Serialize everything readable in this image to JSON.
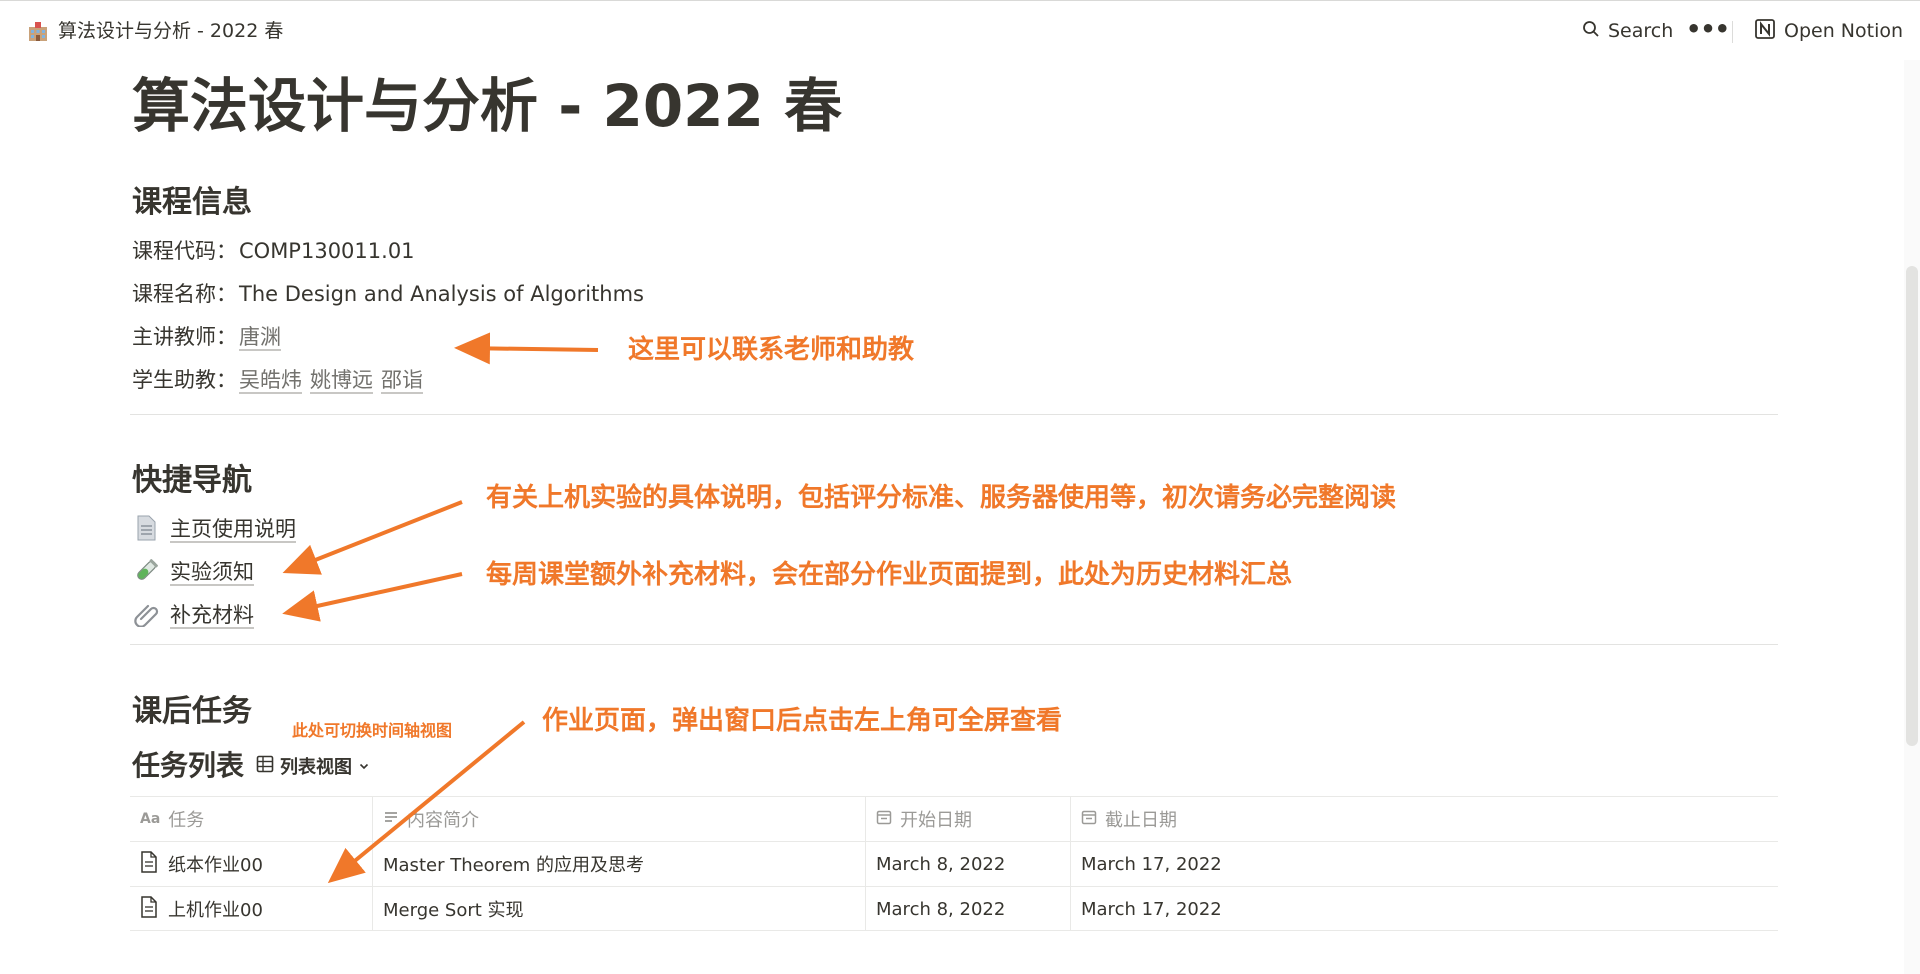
{
  "topbar": {
    "breadcrumb": "算法设计与分析 - 2022 春",
    "search_label": "Search",
    "more_label": "•••",
    "open_notion_label": "Open Notion"
  },
  "page": {
    "title": "算法设计与分析 - 2022 春"
  },
  "course_info": {
    "heading": "课程信息",
    "code_label": "课程代码：",
    "code_value": "COMP130011.01",
    "name_label": "课程名称：",
    "name_value": "The Design and Analysis of Algorithms",
    "teacher_label": "主讲教师：",
    "teacher": "唐渊",
    "ta_label": "学生助教：",
    "tas": [
      "吴皓炜",
      "姚博远",
      "邵诣"
    ]
  },
  "quick_nav": {
    "heading": "快捷导航",
    "links": [
      {
        "label": "主页使用说明",
        "icon": "page-icon"
      },
      {
        "label": "实验须知",
        "icon": "test-tube-icon"
      },
      {
        "label": "补充材料",
        "icon": "paperclip-icon"
      }
    ]
  },
  "tasks": {
    "heading": "课后任务",
    "db_title": "任务列表",
    "view_label": "列表视图",
    "columns": [
      "任务",
      "内容简介",
      "开始日期",
      "截止日期"
    ],
    "rows": [
      {
        "name": "纸本作业00",
        "desc": "Master Theorem 的应用及思考",
        "start": "March 8, 2022",
        "due": "March 17, 2022"
      },
      {
        "name": "上机作业00",
        "desc": "Merge Sort 实现",
        "start": "March 8, 2022",
        "due": "March 17, 2022"
      }
    ]
  },
  "annotations": {
    "contact": "这里可以联系老师和助教",
    "lab": "有关上机实验的具体说明，包括评分标准、服务器使用等，初次请务必完整阅读",
    "materials": "每周课堂额外补充材料，会在部分作业页面提到，此处为历史材料汇总",
    "timeline": "此处可切换时间轴视图",
    "homework": "作业页面，弹出窗口后点击左上角可全屏查看",
    "color": "#f0782a"
  }
}
